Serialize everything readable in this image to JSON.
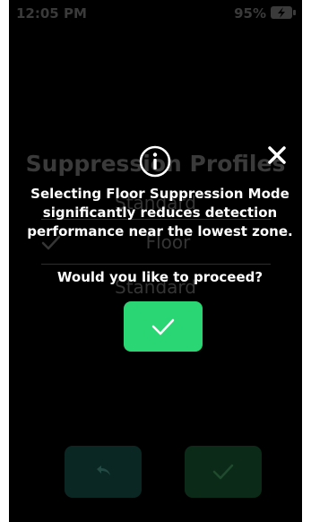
{
  "status_bar": {
    "time": "12:05 PM",
    "battery_percent": "95%",
    "battery_icon": "battery-charging-icon"
  },
  "background_screen": {
    "title": "Suppression Profiles",
    "options": [
      "Standard",
      "Floor",
      "Standard"
    ],
    "selected_option_icon": "checkmark-icon",
    "back_button_icon": "undo-arrow-icon",
    "confirm_button_icon": "checkmark-icon"
  },
  "modal": {
    "icon": "info-circle-icon",
    "close_icon": "close-x-icon",
    "message": "Selecting Floor Suppression Mode significantly reduces detection performance near the lowest zone.",
    "question": "Would you like to proceed?",
    "proceed_button_icon": "checkmark-icon"
  },
  "colors": {
    "screen_background": "#000000",
    "modal_text": "#ffffff",
    "accent_green": "#2ad673",
    "dim_text": "#3a3a3a",
    "dim_back_button": "#0b2724",
    "dim_confirm_button": "#0b2b18"
  }
}
